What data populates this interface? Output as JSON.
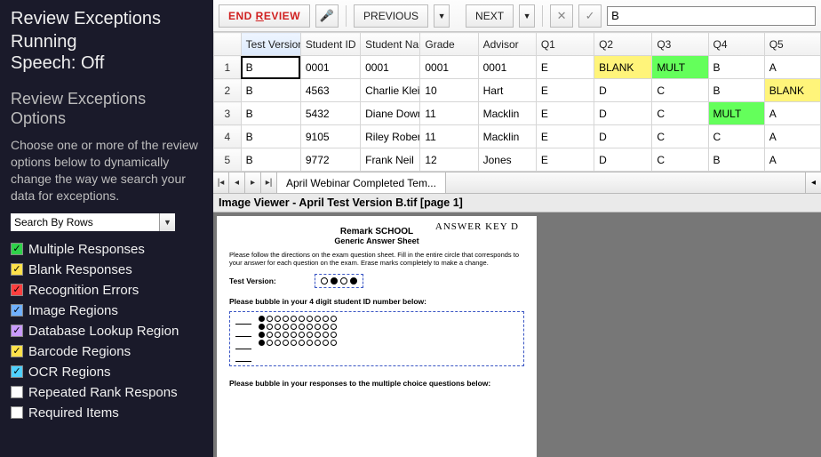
{
  "left": {
    "title": "Review Exceptions Running",
    "subtitle": "Speech: Off",
    "section_title_line1": "Review Exceptions",
    "section_title_line2": "Options",
    "desc": "Choose one or more of the review options below to dynamically change the way we search your data for exceptions.",
    "dropdown_label": "Search By Rows",
    "options": [
      {
        "color": "green",
        "checked": true,
        "label": "Multiple Responses"
      },
      {
        "color": "yellow",
        "checked": true,
        "label": "Blank Responses"
      },
      {
        "color": "red",
        "checked": true,
        "label": "Recognition Errors"
      },
      {
        "color": "blue",
        "checked": true,
        "label": "Image Regions"
      },
      {
        "color": "purple",
        "checked": true,
        "label": "Database Lookup Region"
      },
      {
        "color": "yellow",
        "checked": true,
        "label": "Barcode Regions"
      },
      {
        "color": "cyan",
        "checked": true,
        "label": "OCR Regions"
      },
      {
        "color": "blank",
        "checked": false,
        "label": "Repeated Rank Respons"
      },
      {
        "color": "blank",
        "checked": false,
        "label": "Required Items"
      }
    ]
  },
  "toolbar": {
    "end_review": "END REVIEW",
    "previous": "PREVIOUS",
    "next": "NEXT",
    "input_value": "B"
  },
  "grid": {
    "columns": [
      "Test Version",
      "Student ID",
      "Student Nam",
      "Grade",
      "Advisor",
      "Q1",
      "Q2",
      "Q3",
      "Q4",
      "Q5"
    ],
    "rows": [
      {
        "n": "1",
        "cells": [
          "B",
          "0001",
          "0001",
          "0001",
          "0001",
          "E",
          "BLANK",
          "MULT",
          "B",
          "A"
        ]
      },
      {
        "n": "2",
        "cells": [
          "B",
          "4563",
          "Charlie Klein",
          "10",
          "Hart",
          "E",
          "D",
          "C",
          "B",
          "BLANK"
        ]
      },
      {
        "n": "3",
        "cells": [
          "B",
          "5432",
          "Diane Down",
          "11",
          "Macklin",
          "E",
          "D",
          "C",
          "MULT",
          "A"
        ]
      },
      {
        "n": "4",
        "cells": [
          "B",
          "9105",
          "Riley Robert",
          "11",
          "Macklin",
          "E",
          "D",
          "C",
          "C",
          "A"
        ]
      },
      {
        "n": "5",
        "cells": [
          "B",
          "9772",
          "Frank Neil",
          "12",
          "Jones",
          "E",
          "D",
          "C",
          "B",
          "A"
        ]
      }
    ],
    "sheet_tab": "April Webinar Completed Tem..."
  },
  "viewer": {
    "title": "Image Viewer - April Test Version B.tif  [page 1]",
    "annotation": "ANSWER KEY D",
    "heading1": "Remark SCHOOL",
    "heading2": "Generic Answer Sheet",
    "instructions": "Please follow the directions on the exam question sheet. Fill in the entire circle that corresponds to your answer for each question on the exam. Erase marks completely to make a change.",
    "test_version_label": "Test Version:",
    "student_id_label": "Please bubble in your 4 digit student ID number below:",
    "mc_label": "Please bubble in your responses to the multiple choice questions below:"
  }
}
